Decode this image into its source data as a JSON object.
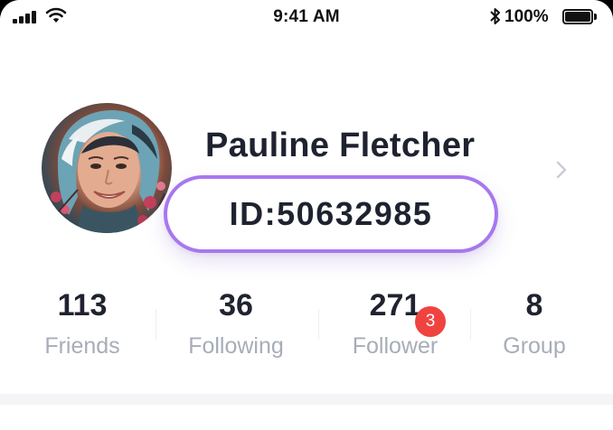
{
  "status_bar": {
    "time": "9:41 AM",
    "battery_percent": "100%",
    "icons": [
      "signal-icon",
      "wifi-icon",
      "bluetooth-icon",
      "battery-icon"
    ]
  },
  "profile": {
    "name": "Pauline Fletcher",
    "id_text": "ID:50632985",
    "avatar": "avatar-photo",
    "highlight_color": "#a877f0"
  },
  "stats": [
    {
      "value": "113",
      "label": "Friends"
    },
    {
      "value": "36",
      "label": "Following"
    },
    {
      "value": "271",
      "label": "Follower",
      "badge": "3"
    },
    {
      "value": "8",
      "label": "Group"
    }
  ],
  "colors": {
    "badge": "#f0433f",
    "label": "#a7adb8",
    "text": "#1f2330"
  }
}
